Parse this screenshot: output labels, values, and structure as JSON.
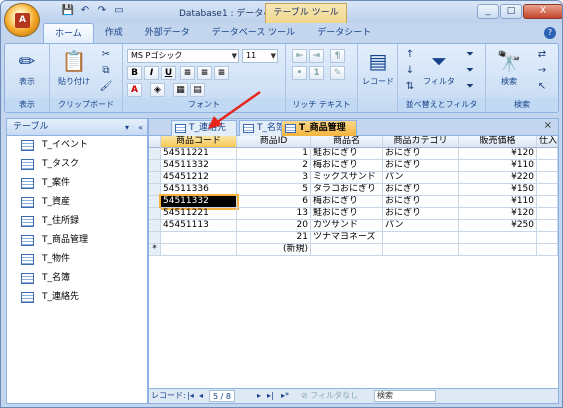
{
  "window": {
    "title": "Database1 : データベース ...",
    "context_tab": "テーブル ツール",
    "controls": [
      "_",
      "□",
      "X"
    ]
  },
  "qat": {
    "save": "💾",
    "undo": "↶",
    "redo": "↷",
    "new": "▭"
  },
  "ribbon_tabs": [
    {
      "label": "ホーム",
      "active": true
    },
    {
      "label": "作成",
      "active": false
    },
    {
      "label": "外部データ",
      "active": false
    },
    {
      "label": "データベース ツール",
      "active": false
    },
    {
      "label": "データシート",
      "active": false
    }
  ],
  "groups": {
    "view": {
      "btn": "表示",
      "label": "表示"
    },
    "clipboard": {
      "btn": "貼り付け",
      "label": "クリップボード"
    },
    "font": {
      "name": "MS Pゴシック",
      "size": "11",
      "label": "フォント",
      "bold": "B",
      "italic": "I",
      "underline": "U"
    },
    "richtext": {
      "label": "リッチ テキスト"
    },
    "records": {
      "btn": "レコード"
    },
    "sort": {
      "btn": "フィルタ",
      "label": "並べ替えとフィルタ"
    },
    "find": {
      "btn": "検索",
      "label": "検索"
    }
  },
  "nav": {
    "header": "テーブル",
    "items": [
      "T_イベント",
      "T_タスク",
      "T_案件",
      "T_資産",
      "T_住所録",
      "T_商品管理",
      "T_物件",
      "T_名簿",
      "T_連絡先"
    ]
  },
  "doc_tabs": [
    {
      "label": "T_連絡先",
      "active": false
    },
    {
      "label": "T_名簿",
      "active": false
    },
    {
      "label": "T_商品管理",
      "active": true
    }
  ],
  "table": {
    "columns": [
      "商品コード",
      "商品ID",
      "商品名",
      "商品カテゴリ",
      "販売価格",
      "仕入"
    ],
    "rows": [
      [
        "54511221",
        "1",
        "鮭おにぎり",
        "おにぎり",
        "¥120"
      ],
      [
        "54511332",
        "2",
        "梅おにぎり",
        "おにぎり",
        "¥110"
      ],
      [
        "45451212",
        "3",
        "ミックスサンド",
        "パン",
        "¥220"
      ],
      [
        "54511336",
        "5",
        "タラコおにぎり",
        "おにぎり",
        "¥150"
      ],
      [
        "54511332",
        "6",
        "梅おにぎり",
        "おにぎり",
        "¥110"
      ],
      [
        "54511221",
        "13",
        "鮭おにぎり",
        "おにぎり",
        "¥120"
      ],
      [
        "45451113",
        "20",
        "カツサンド",
        "パン",
        "¥250"
      ],
      [
        "",
        "21",
        "ツナマヨネーズ",
        "",
        ""
      ]
    ],
    "new_row_marker": "*",
    "new_row_label": "(新規)",
    "selected_row": 4
  },
  "status": {
    "record_label": "レコード:",
    "position": "5 / 8",
    "filter": "フィルタなし",
    "search": "検索"
  }
}
